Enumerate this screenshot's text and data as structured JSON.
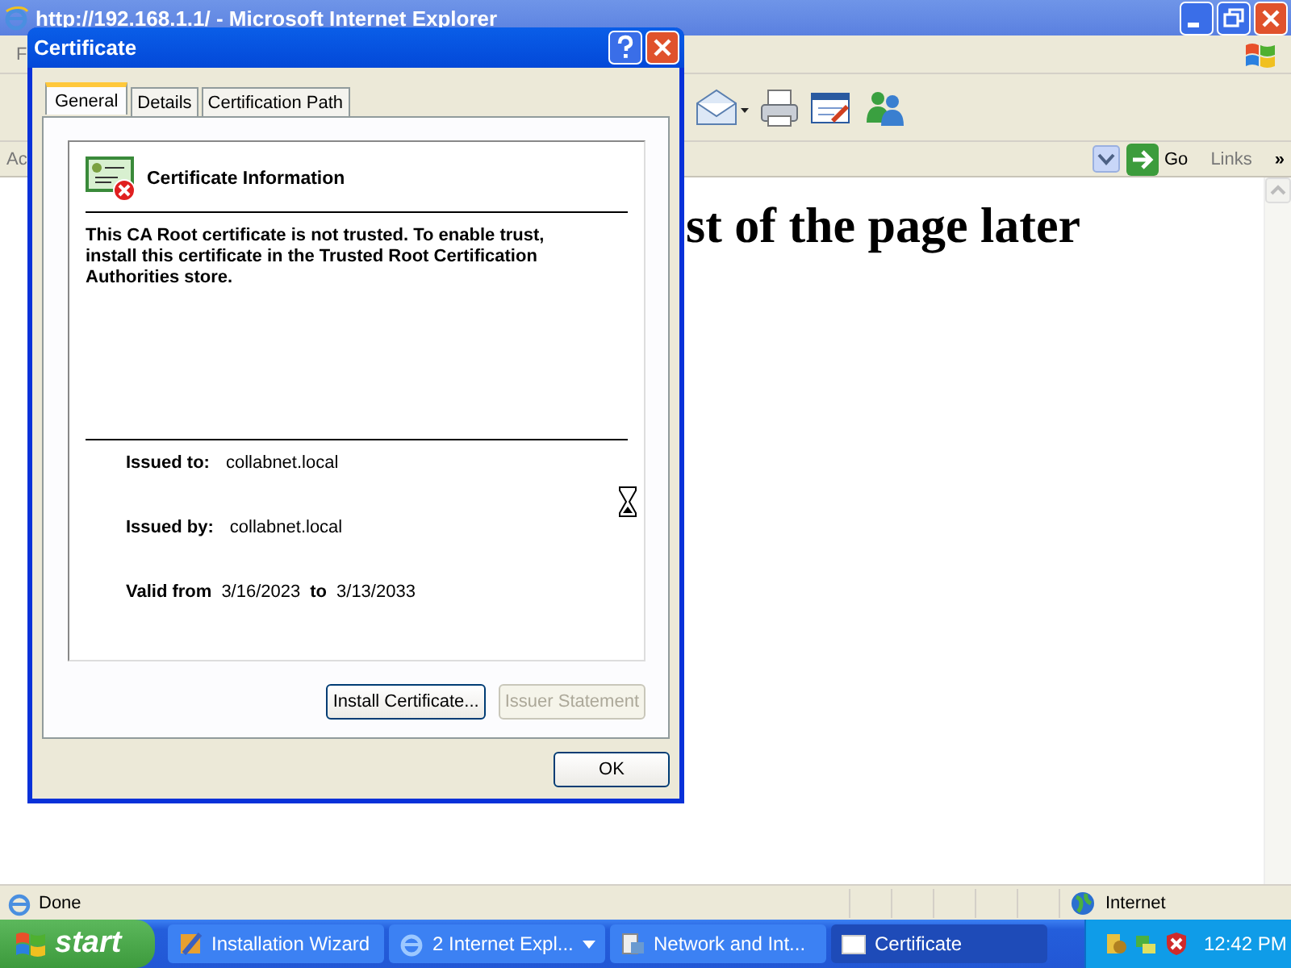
{
  "browser": {
    "title": "http://192.168.1.1/ - Microsoft Internet Explorer",
    "menu_text": "F",
    "address_label": "Ac",
    "go_button": "Go",
    "links": "Links",
    "links_chevron": "»",
    "heading": "st of the page later",
    "status": "Done",
    "zone": "Internet"
  },
  "dialog": {
    "title": "Certificate",
    "tabs": [
      {
        "label": "General",
        "selected": true
      },
      {
        "label": "Details",
        "selected": false
      },
      {
        "label": "Certification Path",
        "selected": false
      }
    ],
    "info_title": "Certificate Information",
    "message": "This CA Root certificate is not trusted. To enable trust, install this certificate in the Trusted Root Certification Authorities store.",
    "fields": [
      {
        "label": "Issued to:",
        "value": "collabnet.local"
      },
      {
        "label": "Issued by:",
        "value": "collabnet.local"
      }
    ],
    "validity": {
      "from_label": "Valid from",
      "from": "3/16/2023",
      "to_label": "to",
      "to": "3/13/2033"
    },
    "buttons": [
      {
        "label": "Install Certificate...",
        "disabled": false
      },
      {
        "label": "Issuer Statement",
        "disabled": true
      }
    ],
    "ok_button": "OK"
  },
  "taskbar": {
    "start": "start",
    "tasks": [
      {
        "label": "Installation Wizard",
        "selected": false,
        "grouped": false
      },
      {
        "label": "2 Internet Expl...",
        "selected": false,
        "grouped": true
      },
      {
        "label": "Network and Int...",
        "selected": false,
        "grouped": false
      },
      {
        "label": "Certificate",
        "selected": true,
        "grouped": false
      }
    ],
    "clock": "12:42 PM"
  }
}
